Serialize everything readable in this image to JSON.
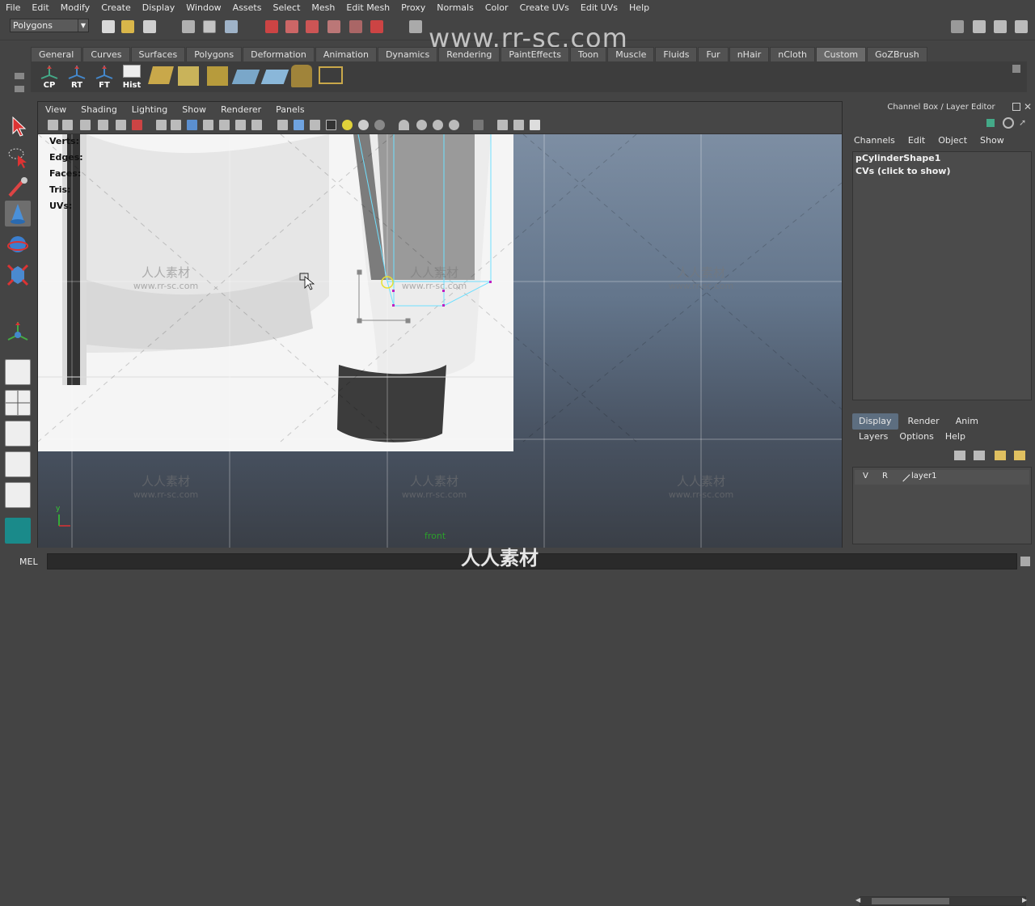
{
  "menubar": [
    "File",
    "Edit",
    "Modify",
    "Create",
    "Display",
    "Window",
    "Assets",
    "Select",
    "Mesh",
    "Edit Mesh",
    "Proxy",
    "Normals",
    "Color",
    "Create UVs",
    "Edit UVs",
    "Help"
  ],
  "status": {
    "mode": "Polygons",
    "watermark": "www.rr-sc.com"
  },
  "shelf": {
    "tabs": [
      "General",
      "Curves",
      "Surfaces",
      "Polygons",
      "Deformation",
      "Animation",
      "Dynamics",
      "Rendering",
      "PaintEffects",
      "Toon",
      "Muscle",
      "Fluids",
      "Fur",
      "nHair",
      "nCloth",
      "Custom",
      "GoZBrush"
    ],
    "active_tab": "Custom",
    "buttons": [
      "CP",
      "RT",
      "FT",
      "Hist"
    ]
  },
  "viewport": {
    "menu": [
      "View",
      "Shading",
      "Lighting",
      "Show",
      "Renderer",
      "Panels"
    ],
    "hud": [
      "Verts:",
      "Edges:",
      "Faces:",
      "Tris:",
      "UVs:"
    ],
    "camera": "front",
    "axis_y": "y",
    "watermark_cn": "人人素材",
    "watermark_url": "www.rr-sc.com"
  },
  "channel_box": {
    "title": "Channel Box / Layer Editor",
    "menu": [
      "Channels",
      "Edit",
      "Object",
      "Show"
    ],
    "object": "pCylinderShape1",
    "cvs": "CVs (click to show)"
  },
  "layer_editor": {
    "tabs": [
      "Display",
      "Render",
      "Anim"
    ],
    "active_tab": "Display",
    "menu": [
      "Layers",
      "Options",
      "Help"
    ],
    "layer": {
      "v": "V",
      "r": "R",
      "name": "layer1"
    }
  },
  "command_line": {
    "label": "MEL",
    "watermark": "人人素材"
  }
}
